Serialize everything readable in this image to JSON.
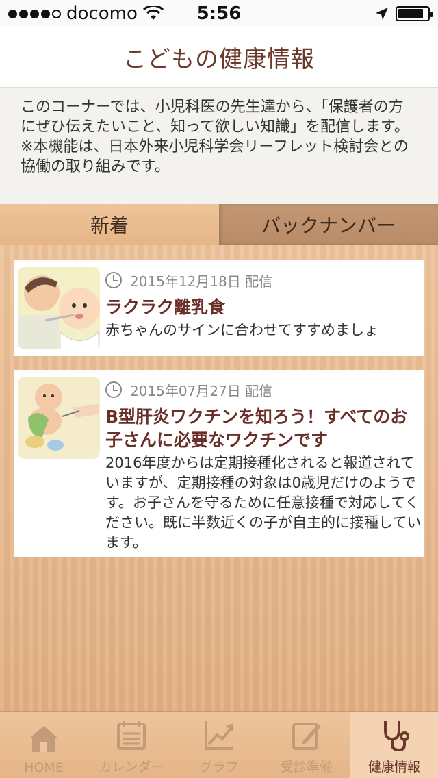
{
  "status_bar": {
    "carrier": "docomo",
    "time": "5:56"
  },
  "header": {
    "title": "こどもの健康情報"
  },
  "intro": {
    "line1": "このコーナーでは、小児科医の先生達から、「保護者の方にぜひ伝えたいこと、知って欲しい知識」を配信します。",
    "line2": "※本機能は、日本外来小児科学会リーフレット検討会との協働の取り組みです。"
  },
  "tabs": [
    {
      "label": "新着"
    },
    {
      "label": "バックナンバー"
    }
  ],
  "articles": [
    {
      "date": "2015年12月18日 配信",
      "title": "ラクラク離乳食",
      "summary": "赤ちゃんのサインに合わせてすすめましょ"
    },
    {
      "date": "2015年07月27日 配信",
      "title": "B型肝炎ワクチンを知ろう！すべてのお子さんに必要なワクチンです",
      "summary": "2016年度からは定期接種化されると報道されていますが、定期接種の対象は0歳児だけのようです。お子さんを守るために任意接種で対応してください。既に半数近くの子が自主的に接種しています。"
    }
  ],
  "tabbar": [
    {
      "label": "HOME",
      "icon": "home-icon"
    },
    {
      "label": "カレンダー",
      "icon": "calendar-icon"
    },
    {
      "label": "グラフ",
      "icon": "graph-icon"
    },
    {
      "label": "受診準備",
      "icon": "edit-icon"
    },
    {
      "label": "健康情報",
      "icon": "stethoscope-icon"
    }
  ],
  "colors": {
    "accent": "#6b3a2a",
    "tab_inactive": "#c49b78",
    "wood": "#e7b98c"
  }
}
